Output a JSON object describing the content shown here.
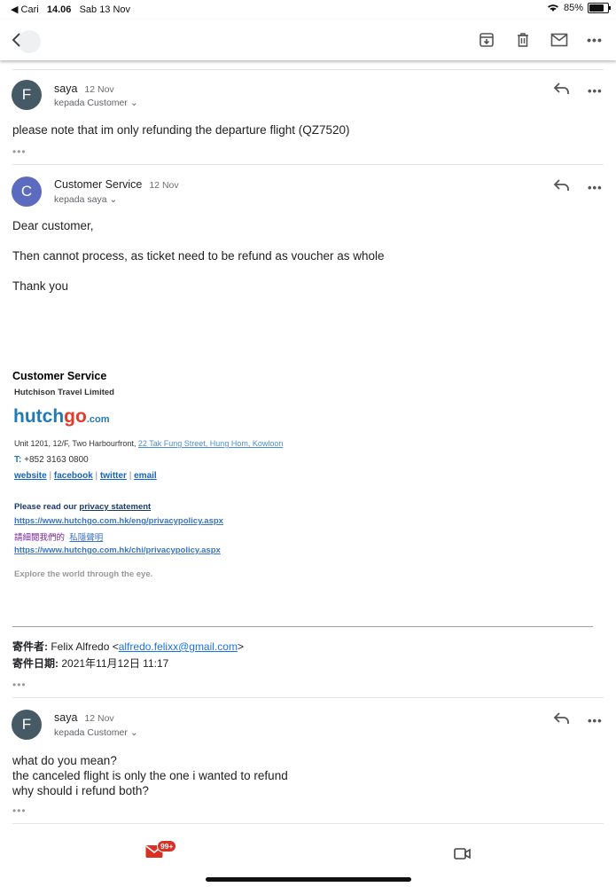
{
  "status_bar": {
    "back_app": "Cari",
    "time": "14.06",
    "date": "Sab 13 Nov",
    "battery": "85%"
  },
  "toolbar": {
    "back": "back",
    "actions": [
      "archive",
      "delete",
      "mark-unread",
      "more"
    ]
  },
  "messages": [
    {
      "avatar": "F",
      "sender": "saya",
      "date": "12 Nov",
      "recipient": "kepada Customer",
      "body": [
        "please note that im only refunding the departure flight (QZ7520)"
      ]
    },
    {
      "avatar": "C",
      "sender": "Customer Service",
      "date": "12 Nov",
      "recipient": "kepada saya",
      "body": [
        "Dear customer,",
        "Then cannot process, as ticket need to be refund as voucher as whole",
        "Thank you"
      ]
    },
    {
      "avatar": "F",
      "sender": "saya",
      "date": "12 Nov",
      "recipient": "kepada Customer",
      "body": [
        "what do you mean?",
        "the canceled flight is only the one i wanted to refund",
        "why should i refund both?"
      ]
    }
  ],
  "signature": {
    "title": "Customer Service",
    "company": "Hutchison Travel Limited",
    "logo_hutch": "hutch",
    "logo_go": "go",
    "logo_com": ".com",
    "address_plain": "Unit 1201, 12/F, Two Harbourfront, ",
    "address_link": "22 Tak Fung Street, Hung Hom, Kowloon",
    "phone_label": "T:",
    "phone": "+852 3163 0800",
    "links": [
      "website",
      "facebook",
      "twitter",
      "email"
    ],
    "privacy_intro": "Please read our ",
    "privacy_link": "privacy statement",
    "privacy_url_en": "https://www.hutchgo.com.hk/eng/privacypolicy.aspx",
    "privacy_intro_zh": "請細閱我們的",
    "privacy_link_zh": "私隱聲明",
    "privacy_url_zh": "https://www.hutchgo.com.hk/chi/privacypolicy.aspx",
    "tagline": "Explore the world through the eye."
  },
  "quoted": {
    "from_label": "寄件者:",
    "from_name": "Felix Alfredo <",
    "from_email": "alfredo.felixx@gmail.com",
    "from_close": ">",
    "date_label": "寄件日期:",
    "date_value": "2021年11月12日 11:17"
  },
  "more_dots": "•••",
  "bottom_nav": {
    "mail_badge": "99+"
  },
  "colors": {
    "accent": "#1a73e8",
    "badge": "#d93025",
    "avatar_f": "#455a64",
    "avatar_c": "#5c6bc0"
  }
}
